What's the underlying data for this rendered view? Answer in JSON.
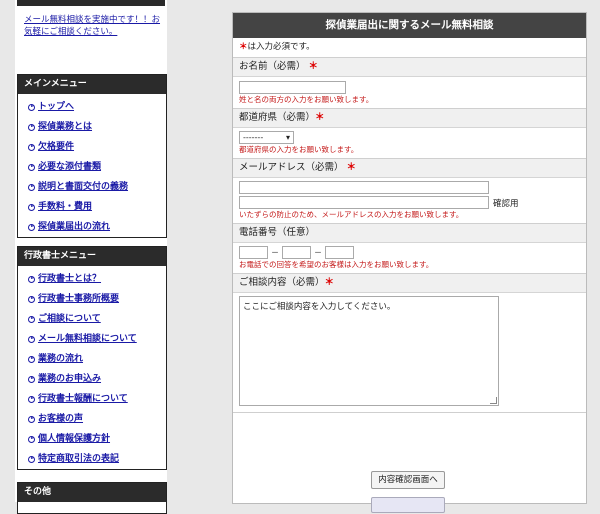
{
  "sidebar": {
    "intro_text": "メール無料相談を実施中です！！お気軽にご相談ください。",
    "main_menu": {
      "title": "メインメニュー",
      "items": [
        "トップへ",
        "探偵業務とは",
        "欠格要件",
        "必要な添付書類",
        "説明と書面交付の義務",
        "手数料・費用",
        "探偵業届出の流れ"
      ]
    },
    "gyosei_menu": {
      "title": "行政書士メニュー",
      "items": [
        "行政書士とは？",
        "行政書士事務所概要",
        "ご相談について",
        "メール無料相談について",
        "業務の流れ",
        "業務のお申込み",
        "行政書士報酬について",
        "お客様の声",
        "個人情報保護方針",
        "特定商取引法の表記"
      ]
    },
    "other_title": "その他"
  },
  "form": {
    "title": "探偵業届出に関するメール無料相談",
    "required_note": "は入力必須です。",
    "required_mark": "＊",
    "name": {
      "label": "お名前（必需）",
      "note": "姓と名の両方の入力をお願い致します。"
    },
    "pref": {
      "label": "都道府県（必需）",
      "selected": "-------",
      "note": "都道府県の入力をお願い致します。"
    },
    "email": {
      "label": "メールアドレス（必需）",
      "confirm_label": "確認用",
      "note": "いたずらの防止のため、メールアドレスの入力をお願い致します。"
    },
    "phone": {
      "label": "電話番号（任意）",
      "dash": "－",
      "note": "お電話での回答を希望のお客様は入力をお願い致します。"
    },
    "content": {
      "label": "ご相談内容（必需）",
      "value": "ここにご相談内容を入力してください。"
    },
    "submit_label": "内容確認画面へ"
  }
}
